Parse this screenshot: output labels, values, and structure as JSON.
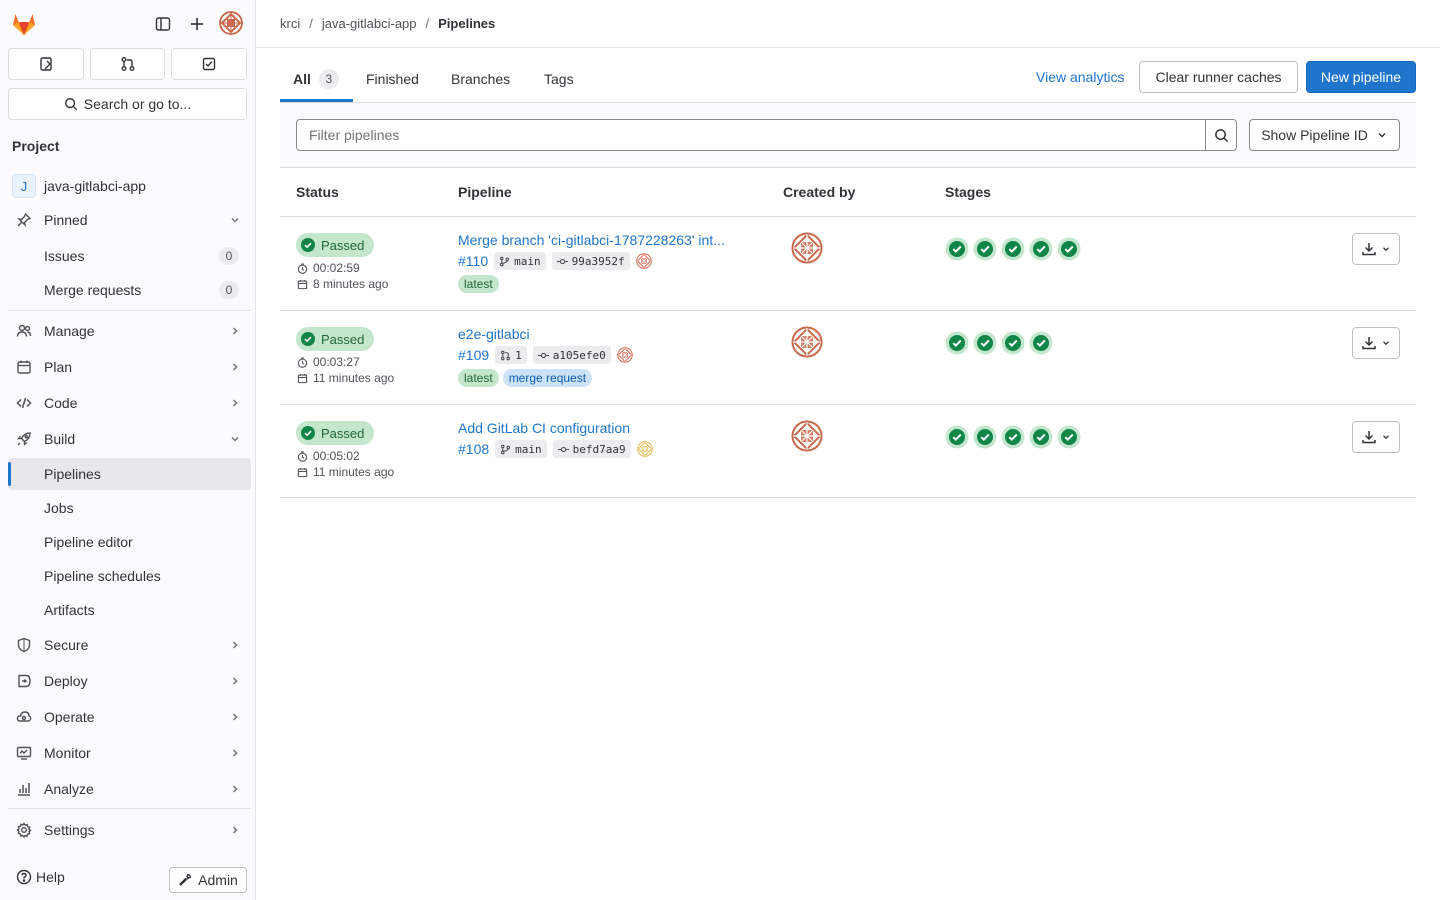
{
  "app": {
    "name": "GitLab"
  },
  "colors": {
    "accent": "#1f75cb",
    "success": "#108548",
    "success_bg": "#c3e6cd"
  },
  "sidebar": {
    "search_label": "Search or go to...",
    "section_title": "Project",
    "project": {
      "initial": "J",
      "name": "java-gitlabci-app"
    },
    "pinned": {
      "label": "Pinned",
      "items": [
        {
          "label": "Issues",
          "count": "0"
        },
        {
          "label": "Merge requests",
          "count": "0"
        }
      ]
    },
    "items": [
      {
        "label": "Manage",
        "icon": "users-icon"
      },
      {
        "label": "Plan",
        "icon": "calendar-icon"
      },
      {
        "label": "Code",
        "icon": "code-icon"
      },
      {
        "label": "Build",
        "icon": "rocket-icon"
      }
    ],
    "build_sub": [
      {
        "label": "Pipelines",
        "active": true
      },
      {
        "label": "Jobs"
      },
      {
        "label": "Pipeline editor"
      },
      {
        "label": "Pipeline schedules"
      },
      {
        "label": "Artifacts"
      }
    ],
    "items2": [
      {
        "label": "Secure",
        "icon": "shield-icon"
      },
      {
        "label": "Deploy",
        "icon": "deploy-icon"
      },
      {
        "label": "Operate",
        "icon": "operate-icon"
      },
      {
        "label": "Monitor",
        "icon": "monitor-icon"
      },
      {
        "label": "Analyze",
        "icon": "chart-icon"
      }
    ],
    "settings": {
      "label": "Settings",
      "icon": "gear-icon"
    },
    "help_label": "Help",
    "admin_label": "Admin"
  },
  "breadcrumb": [
    "krci",
    "java-gitlabci-app",
    "Pipelines"
  ],
  "tabs": [
    {
      "label": "All",
      "count": "3"
    },
    {
      "label": "Finished"
    },
    {
      "label": "Branches"
    },
    {
      "label": "Tags"
    }
  ],
  "actions": {
    "view_analytics": "View analytics",
    "clear_caches": "Clear runner caches",
    "new_pipeline": "New pipeline"
  },
  "filter": {
    "placeholder": "Filter pipelines",
    "select_label": "Show Pipeline ID"
  },
  "table": {
    "headers": [
      "Status",
      "Pipeline",
      "Created by",
      "Stages"
    ],
    "rows": [
      {
        "status": "Passed",
        "duration": "00:02:59",
        "finished": "8 minutes ago",
        "title": "Merge branch 'ci-gitlabci-1787228263' int...",
        "id": "#110",
        "ref": "main",
        "ref_icon": "branch-icon",
        "commit": "99a3952f",
        "tags": [
          "latest"
        ],
        "stages": 5
      },
      {
        "status": "Passed",
        "duration": "00:03:27",
        "finished": "11 minutes ago",
        "title": "e2e-gitlabci",
        "id": "#109",
        "ref": "1",
        "ref_icon": "merge-request-icon",
        "commit": "a105efe0",
        "tags": [
          "latest",
          "merge request"
        ],
        "stages": 4
      },
      {
        "status": "Passed",
        "duration": "00:05:02",
        "finished": "11 minutes ago",
        "title": "Add GitLab CI configuration",
        "id": "#108",
        "ref": "main",
        "ref_icon": "branch-icon",
        "commit": "befd7aa9",
        "tags": [],
        "stages": 5
      }
    ]
  }
}
